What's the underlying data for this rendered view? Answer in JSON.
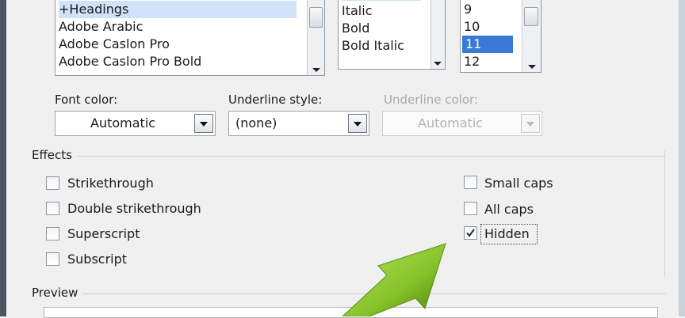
{
  "font_list": {
    "items": [
      "+Headings",
      "Adobe Arabic",
      "Adobe Caslon Pro",
      "Adobe Caslon Pro Bold"
    ]
  },
  "style_list": {
    "items": [
      "Italic",
      "Bold",
      "Bold Italic"
    ]
  },
  "size_list": {
    "items": [
      "9",
      "10",
      "11",
      "12"
    ],
    "selected": "11"
  },
  "font_color": {
    "label": "Font color:",
    "value": "Automatic"
  },
  "underline_style": {
    "label": "Underline style:",
    "value": "(none)"
  },
  "underline_color": {
    "label": "Underline color:",
    "value": "Automatic"
  },
  "effects": {
    "title": "Effects",
    "left": [
      {
        "label": "Strikethrough",
        "checked": false
      },
      {
        "label": "Double strikethrough",
        "checked": false
      },
      {
        "label": "Superscript",
        "checked": false
      },
      {
        "label": "Subscript",
        "checked": false
      }
    ],
    "right": [
      {
        "label": "Small caps",
        "checked": false
      },
      {
        "label": "All caps",
        "checked": false
      },
      {
        "label": "Hidden",
        "checked": true
      }
    ]
  },
  "preview": {
    "title": "Preview"
  },
  "colors": {
    "selection": "#3b79d6",
    "arrow_light": "#9fd33c",
    "arrow_dark": "#5e8f16"
  }
}
